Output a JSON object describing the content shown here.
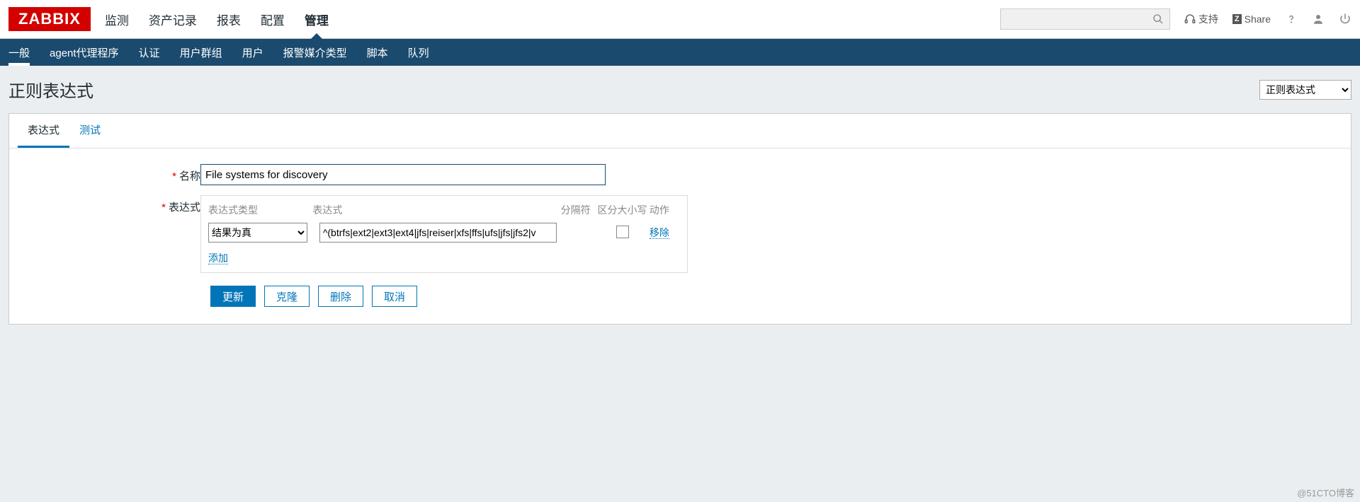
{
  "logo": "ZABBIX",
  "top_menu": {
    "items": [
      "监测",
      "资产记录",
      "报表",
      "配置",
      "管理"
    ],
    "active": 4
  },
  "search": {
    "placeholder": ""
  },
  "support": "支持",
  "share": "Share",
  "sub_nav": {
    "items": [
      "一般",
      "agent代理程序",
      "认证",
      "用户群组",
      "用户",
      "报警媒介类型",
      "脚本",
      "队列"
    ],
    "active": 0
  },
  "page_title": "正则表达式",
  "right_select": {
    "value": "正则表达式"
  },
  "tabs": {
    "items": [
      "表达式",
      "测试"
    ],
    "active": 0
  },
  "form": {
    "name_label": "名称",
    "name_value": "File systems for discovery",
    "expr_label": "表达式",
    "headers": {
      "type": "表达式类型",
      "expr": "表达式",
      "sep": "分隔符",
      "case": "区分大小写",
      "act": "动作"
    },
    "row": {
      "type_option": "结果为真",
      "expr_value": "^(btrfs|ext2|ext3|ext4|jfs|reiser|xfs|ffs|ufs|jfs|jfs2|v",
      "remove": "移除"
    },
    "add_link": "添加",
    "buttons": {
      "update": "更新",
      "clone": "克隆",
      "delete": "删除",
      "cancel": "取消"
    }
  },
  "watermark": "@51CTO博客"
}
